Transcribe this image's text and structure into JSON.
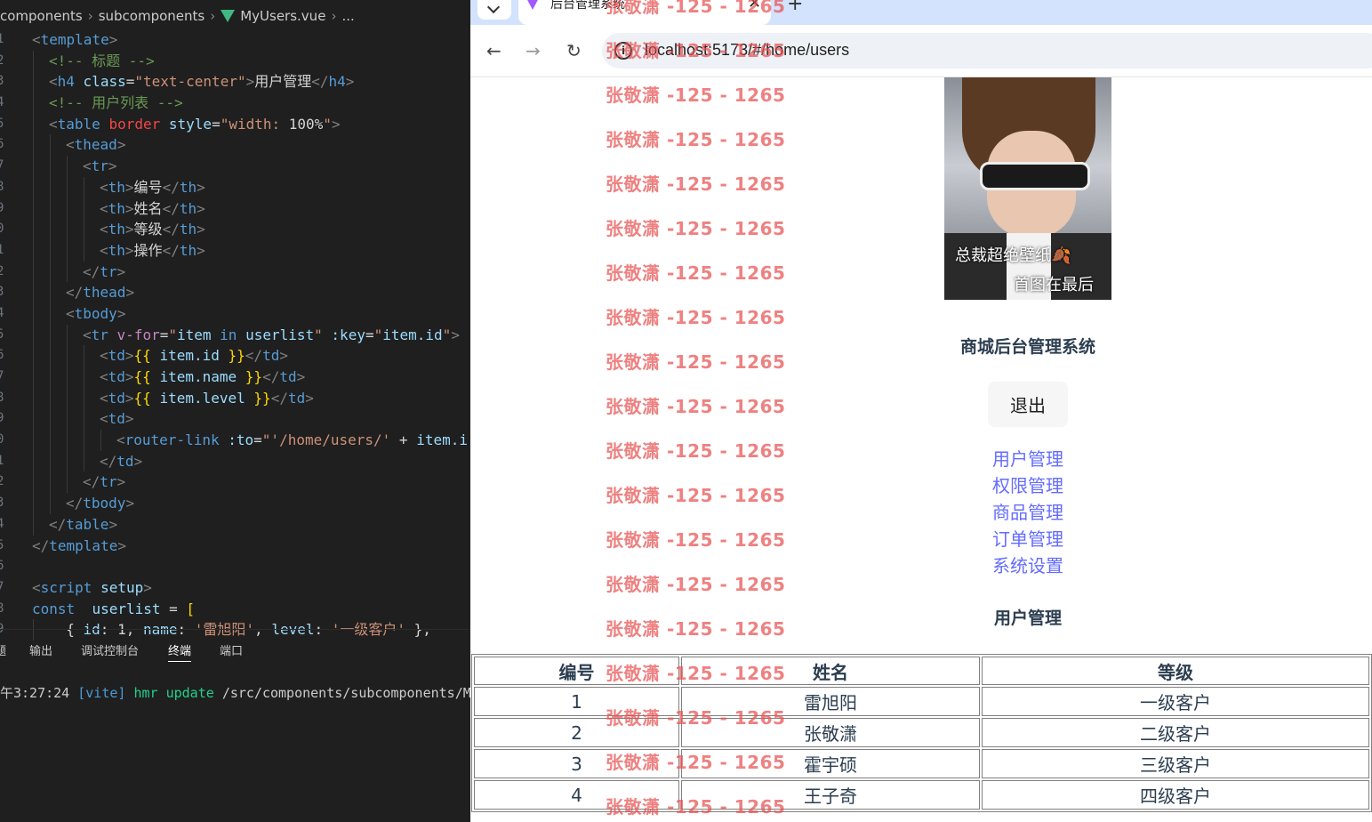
{
  "editor": {
    "breadcrumb": [
      "components",
      "subcomponents",
      "MyUsers.vue",
      "..."
    ],
    "line_numbers": [
      "1",
      "2",
      "3",
      "4",
      "5",
      "6",
      "7",
      "8",
      "9",
      "0",
      "1",
      "2",
      "3",
      "4",
      "5",
      "6",
      "7",
      "8",
      "9",
      "0",
      "1",
      "2",
      "3",
      "4",
      "5",
      "6",
      "7",
      "8",
      "9"
    ],
    "lines": [
      [
        {
          "c": "t-br",
          "t": "<"
        },
        {
          "c": "t-tag",
          "t": "template"
        },
        {
          "c": "t-br",
          "t": ">"
        }
      ],
      [
        {
          "c": "t-cmt",
          "t": "<!-- 标题 -->"
        }
      ],
      [
        {
          "c": "t-br",
          "t": "<"
        },
        {
          "c": "t-tag",
          "t": "h4"
        },
        {
          "c": "t-plain",
          "t": " "
        },
        {
          "c": "t-attr",
          "t": "class"
        },
        {
          "c": "t-plain",
          "t": "="
        },
        {
          "c": "t-str",
          "t": "\"text-center\""
        },
        {
          "c": "t-br",
          "t": ">"
        },
        {
          "c": "t-plain",
          "t": "用户管理"
        },
        {
          "c": "t-br",
          "t": "</"
        },
        {
          "c": "t-tag",
          "t": "h4"
        },
        {
          "c": "t-br",
          "t": ">"
        }
      ],
      [
        {
          "c": "t-cmt",
          "t": "<!-- 用户列表 -->"
        }
      ],
      [
        {
          "c": "t-br",
          "t": "<"
        },
        {
          "c": "t-tag",
          "t": "table"
        },
        {
          "c": "t-plain",
          "t": " "
        },
        {
          "c": "t-red",
          "t": "border"
        },
        {
          "c": "t-plain",
          "t": " "
        },
        {
          "c": "t-attr",
          "t": "style"
        },
        {
          "c": "t-plain",
          "t": "="
        },
        {
          "c": "t-str",
          "t": "\"width: "
        },
        {
          "c": "t-plain",
          "t": "100%"
        },
        {
          "c": "t-str",
          "t": "\""
        },
        {
          "c": "t-br",
          "t": ">"
        }
      ],
      [
        {
          "c": "t-br",
          "t": "<"
        },
        {
          "c": "t-tag",
          "t": "thead"
        },
        {
          "c": "t-br",
          "t": ">"
        }
      ],
      [
        {
          "c": "t-br",
          "t": "<"
        },
        {
          "c": "t-tag",
          "t": "tr"
        },
        {
          "c": "t-br",
          "t": ">"
        }
      ],
      [
        {
          "c": "t-br",
          "t": "<"
        },
        {
          "c": "t-tag",
          "t": "th"
        },
        {
          "c": "t-br",
          "t": ">"
        },
        {
          "c": "t-plain",
          "t": "编号"
        },
        {
          "c": "t-br",
          "t": "</"
        },
        {
          "c": "t-tag",
          "t": "th"
        },
        {
          "c": "t-br",
          "t": ">"
        }
      ],
      [
        {
          "c": "t-br",
          "t": "<"
        },
        {
          "c": "t-tag",
          "t": "th"
        },
        {
          "c": "t-br",
          "t": ">"
        },
        {
          "c": "t-plain",
          "t": "姓名"
        },
        {
          "c": "t-br",
          "t": "</"
        },
        {
          "c": "t-tag",
          "t": "th"
        },
        {
          "c": "t-br",
          "t": ">"
        }
      ],
      [
        {
          "c": "t-br",
          "t": "<"
        },
        {
          "c": "t-tag",
          "t": "th"
        },
        {
          "c": "t-br",
          "t": ">"
        },
        {
          "c": "t-plain",
          "t": "等级"
        },
        {
          "c": "t-br",
          "t": "</"
        },
        {
          "c": "t-tag",
          "t": "th"
        },
        {
          "c": "t-br",
          "t": ">"
        }
      ],
      [
        {
          "c": "t-br",
          "t": "<"
        },
        {
          "c": "t-tag",
          "t": "th"
        },
        {
          "c": "t-br",
          "t": ">"
        },
        {
          "c": "t-plain",
          "t": "操作"
        },
        {
          "c": "t-br",
          "t": "</"
        },
        {
          "c": "t-tag",
          "t": "th"
        },
        {
          "c": "t-br",
          "t": ">"
        }
      ],
      [
        {
          "c": "t-br",
          "t": "</"
        },
        {
          "c": "t-tag",
          "t": "tr"
        },
        {
          "c": "t-br",
          "t": ">"
        }
      ],
      [
        {
          "c": "t-br",
          "t": "</"
        },
        {
          "c": "t-tag",
          "t": "thead"
        },
        {
          "c": "t-br",
          "t": ">"
        }
      ],
      [
        {
          "c": "t-br",
          "t": "<"
        },
        {
          "c": "t-tag",
          "t": "tbody"
        },
        {
          "c": "t-br",
          "t": ">"
        }
      ],
      [
        {
          "c": "t-br",
          "t": "<"
        },
        {
          "c": "t-tag",
          "t": "tr"
        },
        {
          "c": "t-plain",
          "t": " "
        },
        {
          "c": "t-kw",
          "t": "v-for"
        },
        {
          "c": "t-plain",
          "t": "="
        },
        {
          "c": "t-str",
          "t": "\""
        },
        {
          "c": "t-var",
          "t": "item"
        },
        {
          "c": "t-plain",
          "t": " "
        },
        {
          "c": "t-key",
          "t": "in"
        },
        {
          "c": "t-plain",
          "t": " "
        },
        {
          "c": "t-var",
          "t": "userlist"
        },
        {
          "c": "t-str",
          "t": "\""
        },
        {
          "c": "t-plain",
          "t": " "
        },
        {
          "c": "t-attr",
          "t": ":key"
        },
        {
          "c": "t-plain",
          "t": "="
        },
        {
          "c": "t-str",
          "t": "\""
        },
        {
          "c": "t-var",
          "t": "item.id"
        },
        {
          "c": "t-str",
          "t": "\""
        },
        {
          "c": "t-br",
          "t": ">"
        }
      ],
      [
        {
          "c": "t-br",
          "t": "<"
        },
        {
          "c": "t-tag",
          "t": "td"
        },
        {
          "c": "t-br",
          "t": ">"
        },
        {
          "c": "t-mus",
          "t": "{{"
        },
        {
          "c": "t-plain",
          "t": " "
        },
        {
          "c": "t-var",
          "t": "item.id"
        },
        {
          "c": "t-plain",
          "t": " "
        },
        {
          "c": "t-mus",
          "t": "}}"
        },
        {
          "c": "t-br",
          "t": "</"
        },
        {
          "c": "t-tag",
          "t": "td"
        },
        {
          "c": "t-br",
          "t": ">"
        }
      ],
      [
        {
          "c": "t-br",
          "t": "<"
        },
        {
          "c": "t-tag",
          "t": "td"
        },
        {
          "c": "t-br",
          "t": ">"
        },
        {
          "c": "t-mus",
          "t": "{{"
        },
        {
          "c": "t-plain",
          "t": " "
        },
        {
          "c": "t-var",
          "t": "item.name"
        },
        {
          "c": "t-plain",
          "t": " "
        },
        {
          "c": "t-mus",
          "t": "}}"
        },
        {
          "c": "t-br",
          "t": "</"
        },
        {
          "c": "t-tag",
          "t": "td"
        },
        {
          "c": "t-br",
          "t": ">"
        }
      ],
      [
        {
          "c": "t-br",
          "t": "<"
        },
        {
          "c": "t-tag",
          "t": "td"
        },
        {
          "c": "t-br",
          "t": ">"
        },
        {
          "c": "t-mus",
          "t": "{{"
        },
        {
          "c": "t-plain",
          "t": " "
        },
        {
          "c": "t-var",
          "t": "item.level"
        },
        {
          "c": "t-plain",
          "t": " "
        },
        {
          "c": "t-mus",
          "t": "}}"
        },
        {
          "c": "t-br",
          "t": "</"
        },
        {
          "c": "t-tag",
          "t": "td"
        },
        {
          "c": "t-br",
          "t": ">"
        }
      ],
      [
        {
          "c": "t-br",
          "t": "<"
        },
        {
          "c": "t-tag",
          "t": "td"
        },
        {
          "c": "t-br",
          "t": ">"
        }
      ],
      [
        {
          "c": "t-br",
          "t": "<"
        },
        {
          "c": "t-tag",
          "t": "router-link"
        },
        {
          "c": "t-plain",
          "t": " "
        },
        {
          "c": "t-attr",
          "t": ":to"
        },
        {
          "c": "t-plain",
          "t": "="
        },
        {
          "c": "t-str",
          "t": "\"'/home/users/'"
        },
        {
          "c": "t-plain",
          "t": " + "
        },
        {
          "c": "t-var",
          "t": "item.i"
        }
      ],
      [
        {
          "c": "t-br",
          "t": "</"
        },
        {
          "c": "t-tag",
          "t": "td"
        },
        {
          "c": "t-br",
          "t": ">"
        }
      ],
      [
        {
          "c": "t-br",
          "t": "</"
        },
        {
          "c": "t-tag",
          "t": "tr"
        },
        {
          "c": "t-br",
          "t": ">"
        }
      ],
      [
        {
          "c": "t-br",
          "t": "</"
        },
        {
          "c": "t-tag",
          "t": "tbody"
        },
        {
          "c": "t-br",
          "t": ">"
        }
      ],
      [
        {
          "c": "t-br",
          "t": "</"
        },
        {
          "c": "t-tag",
          "t": "table"
        },
        {
          "c": "t-br",
          "t": ">"
        }
      ],
      [
        {
          "c": "t-br",
          "t": "</"
        },
        {
          "c": "t-tag",
          "t": "template"
        },
        {
          "c": "t-br",
          "t": ">"
        }
      ],
      [],
      [
        {
          "c": "t-br",
          "t": "<"
        },
        {
          "c": "t-tag",
          "t": "script"
        },
        {
          "c": "t-plain",
          "t": " "
        },
        {
          "c": "t-attr",
          "t": "setup"
        },
        {
          "c": "t-br",
          "t": ">"
        }
      ],
      [
        {
          "c": "t-key",
          "t": "const"
        },
        {
          "c": "t-plain",
          "t": "  "
        },
        {
          "c": "t-var",
          "t": "userlist"
        },
        {
          "c": "t-plain",
          "t": " = "
        },
        {
          "c": "t-mus",
          "t": "["
        }
      ],
      [
        {
          "c": "t-plain",
          "t": "  { "
        },
        {
          "c": "t-var",
          "t": "id"
        },
        {
          "c": "t-plain",
          "t": ": "
        },
        {
          "c": "t-plain",
          "t": "1"
        },
        {
          "c": "t-plain",
          "t": ", "
        },
        {
          "c": "t-var",
          "t": "name"
        },
        {
          "c": "t-plain",
          "t": ": "
        },
        {
          "c": "t-str",
          "t": "'雷旭阳'"
        },
        {
          "c": "t-plain",
          "t": ", "
        },
        {
          "c": "t-var",
          "t": "level"
        },
        {
          "c": "t-plain",
          "t": ": "
        },
        {
          "c": "t-str",
          "t": "'一级客户'"
        },
        {
          "c": "t-plain",
          "t": " },"
        }
      ]
    ],
    "panel_tabs": [
      "题",
      "输出",
      "调试控制台",
      "终端",
      "端口"
    ],
    "active_panel_tab": "终端",
    "terminal_line": {
      "time": "午3:27:24",
      "tag": "[vite]",
      "event": "hmr update",
      "path": "/src/components/subcomponents/My"
    }
  },
  "browser": {
    "tab_title": "后台管理系统",
    "url": "localhost:5173/#/home/users",
    "page": {
      "photo_caption_1": "总裁超绝壁纸🍂",
      "photo_caption_2": "首图在最后",
      "site_title": "商城后台管理系统",
      "logout_label": "退出",
      "nav_links": [
        "用户管理",
        "权限管理",
        "商品管理",
        "订单管理",
        "系统设置"
      ],
      "section_title": "用户管理",
      "table": {
        "headers": [
          "编号",
          "姓名",
          "等级"
        ],
        "rows": [
          [
            "1",
            "雷旭阳",
            "一级客户"
          ],
          [
            "2",
            "张敬潇",
            "二级客户"
          ],
          [
            "3",
            "霍宇硕",
            "三级客户"
          ],
          [
            "4",
            "王子奇",
            "四级客户"
          ]
        ]
      }
    }
  },
  "watermark_text": "张敬潇 -125 - 1265",
  "colors": {
    "editor_bg": "#1f1f1f",
    "link": "#646cff",
    "watermark": "#e85050",
    "tabstrip": "#d3e3fd"
  }
}
